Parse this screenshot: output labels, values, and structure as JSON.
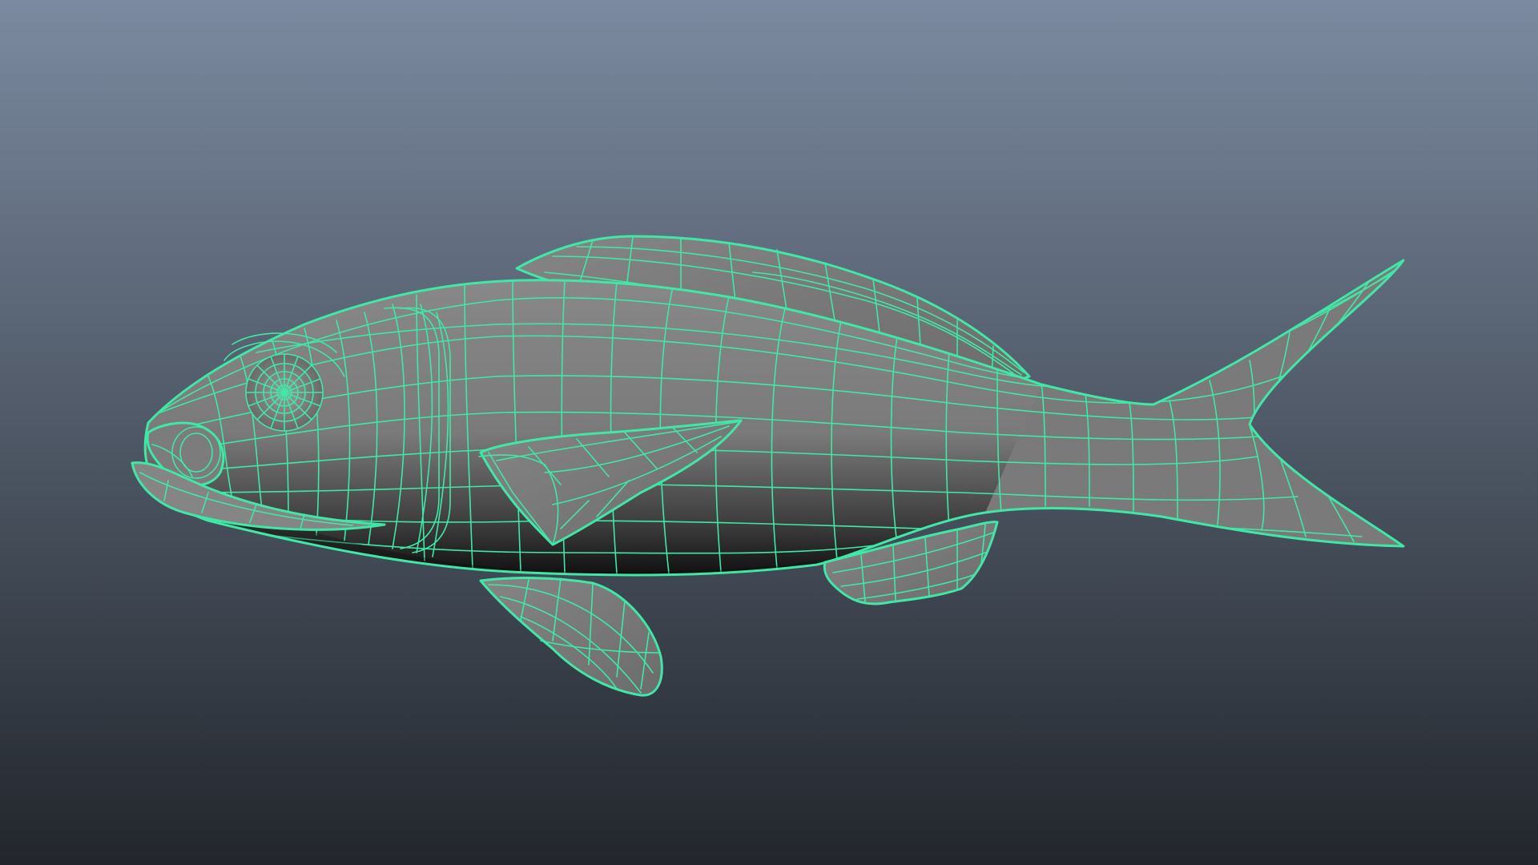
{
  "viewport": {
    "background_top": "#7b8aa0",
    "background_bottom": "#22262c",
    "shaded_surface": "#7a7a7a",
    "wireframe_color": "#3fe8a6",
    "selected_object": "fish-model",
    "display_mode": "wireframe-on-shaded"
  }
}
